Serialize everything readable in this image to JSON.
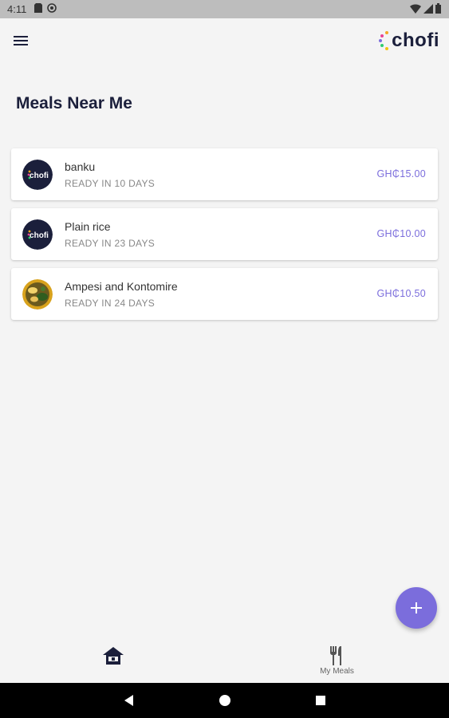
{
  "status_bar": {
    "time": "4:11"
  },
  "app_bar": {
    "logo_text": "chofi"
  },
  "page": {
    "title": "Meals Near Me"
  },
  "meals": [
    {
      "name": "banku",
      "ready": "READY IN 10 DAYS",
      "price": "GH₵15.00",
      "avatar": "chofi-logo"
    },
    {
      "name": "Plain rice",
      "ready": "READY IN 23 DAYS",
      "price": "GH₵10.00",
      "avatar": "chofi-logo"
    },
    {
      "name": "Ampesi and Kontomire",
      "ready": "READY IN 24 DAYS",
      "price": "GH₵10.50",
      "avatar": "food-photo"
    }
  ],
  "bottom_nav": {
    "my_meals_label": "My Meals"
  },
  "colors": {
    "accent": "#7b6ddc",
    "navy": "#1b1f3b"
  }
}
